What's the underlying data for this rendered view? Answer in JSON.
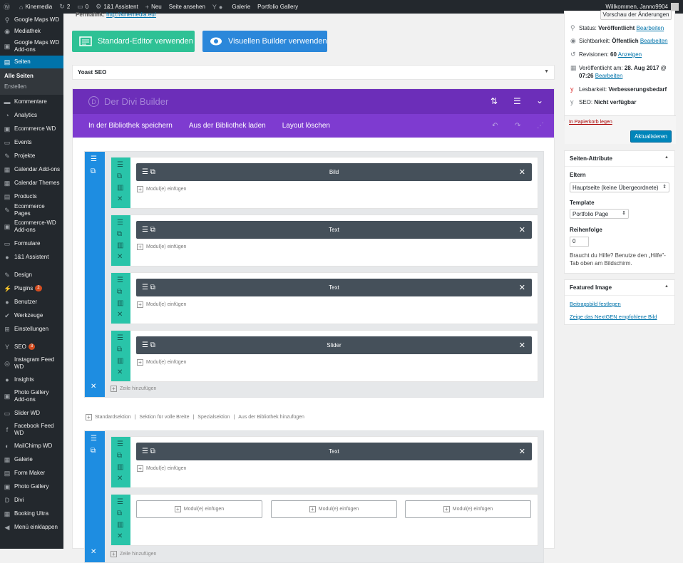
{
  "adminbar": {
    "site": "Kinemedia",
    "updates": "2",
    "comments": "0",
    "assistant": "1&1 Assistent",
    "new": "Neu",
    "view": "Seite ansehen",
    "gallery": "Galerie",
    "portfolio": "Portfolio Gallery",
    "welcome": "Willkommen, Janno9904"
  },
  "sidebar": {
    "items": [
      {
        "label": "Google Maps WD",
        "icon": "map-pin-icon"
      },
      {
        "label": "Mediathek",
        "icon": "media-icon"
      },
      {
        "label": "Google Maps WD Add-ons",
        "icon": "plugin-icon"
      },
      {
        "label": "Seiten",
        "icon": "pages-icon"
      },
      {
        "label": "Kommentare",
        "icon": "comments-icon"
      },
      {
        "label": "Analytics",
        "icon": "analytics-icon"
      },
      {
        "label": "Ecommerce WD",
        "icon": "ecommerce-icon"
      },
      {
        "label": "Events",
        "icon": "events-icon"
      },
      {
        "label": "Projekte",
        "icon": "pin-icon"
      },
      {
        "label": "Calendar Add-ons",
        "icon": "calendar-icon"
      },
      {
        "label": "Calendar Themes",
        "icon": "calendar-icon"
      },
      {
        "label": "Products",
        "icon": "products-icon"
      },
      {
        "label": "Ecommerce Pages",
        "icon": "pin-icon"
      },
      {
        "label": "Ecommerce-WD Add-ons",
        "icon": "plugin-icon"
      },
      {
        "label": "Formulare",
        "icon": "forms-icon"
      },
      {
        "label": "1&1 Assistent",
        "icon": "assistant-icon"
      },
      {
        "label": "Design",
        "icon": "design-icon"
      },
      {
        "label": "Plugins",
        "icon": "plugins-icon",
        "badge": "2"
      },
      {
        "label": "Benutzer",
        "icon": "users-icon"
      },
      {
        "label": "Werkzeuge",
        "icon": "tools-icon"
      },
      {
        "label": "Einstellungen",
        "icon": "settings-icon"
      },
      {
        "label": "SEO",
        "icon": "seo-icon",
        "badge": "3"
      },
      {
        "label": "Instagram Feed WD",
        "icon": "instagram-icon"
      },
      {
        "label": "Insights",
        "icon": "insights-icon"
      },
      {
        "label": "Photo Gallery Add-ons",
        "icon": "plugin-icon"
      },
      {
        "label": "Slider WD",
        "icon": "slider-icon"
      },
      {
        "label": "Facebook Feed WD",
        "icon": "facebook-icon"
      },
      {
        "label": "MailChimp WD",
        "icon": "mailchimp-icon"
      },
      {
        "label": "Galerie",
        "icon": "gallery-icon"
      },
      {
        "label": "Form Maker",
        "icon": "form-maker-icon"
      },
      {
        "label": "Photo Gallery",
        "icon": "photo-gallery-icon"
      },
      {
        "label": "Divi",
        "icon": "divi-icon"
      },
      {
        "label": "Booking Ultra",
        "icon": "booking-icon"
      },
      {
        "label": "Menü einklappen",
        "icon": "collapse-icon"
      }
    ],
    "submenu": [
      "Alle Seiten",
      "Erstellen"
    ]
  },
  "editor": {
    "permalink_label": "Permalink:",
    "permalink_url": "http://kinemedia.eu/",
    "std_button": "Standard-Editor verwenden",
    "vis_button": "Visuellen Builder verwenden",
    "yoast": "Yoast SEO"
  },
  "divi": {
    "title": "Der Divi Builder",
    "tabs": [
      "In der Bibliothek speichern",
      "Aus der Bibliothek laden",
      "Layout löschen"
    ],
    "insert_module": "Modul(e) einfügen",
    "add_row": "Zeile hinzufügen",
    "modules": [
      "Bild",
      "Text",
      "Text",
      "Slider",
      "Text"
    ],
    "section_links": [
      "Standardsektion",
      "Sektion für volle Breite",
      "Spezialsektion",
      "Aus der Bibliothek hinzufügen"
    ]
  },
  "publish": {
    "preview": "Vorschau der Änderungen",
    "status_label": "Status:",
    "status_value": "Veröffentlicht",
    "visibility_label": "Sichtbarkeit:",
    "visibility_value": "Öffentlich",
    "revisions_label": "Revisionen:",
    "revisions_value": "60",
    "revisions_link": "Anzeigen",
    "published_label": "Veröffentlicht am:",
    "published_value": "28. Aug 2017 @ 07:26",
    "edit": "Bearbeiten",
    "readability_label": "Lesbarkeit:",
    "readability_value": "Verbesserungsbedarf",
    "seo_label": "SEO:",
    "seo_value": "Nicht verfügbar",
    "trash": "In Papierkorb legen",
    "update": "Aktualisieren"
  },
  "page_attributes": {
    "title": "Seiten-Attribute",
    "parent_label": "Eltern",
    "parent_value": "Hauptseite (keine Übergeordnete)",
    "template_label": "Template",
    "template_value": "Portfolio Page",
    "order_label": "Reihenfolge",
    "order_value": "0",
    "help": "Braucht du Hilfe? Benutze den „Hilfe\"-Tab oben am Bildschirm."
  },
  "featured": {
    "title": "Featured Image",
    "set_link": "Beitragsbild festlegen",
    "nextgen_link": "Zeige das NextGEN empfohlene Bild"
  }
}
